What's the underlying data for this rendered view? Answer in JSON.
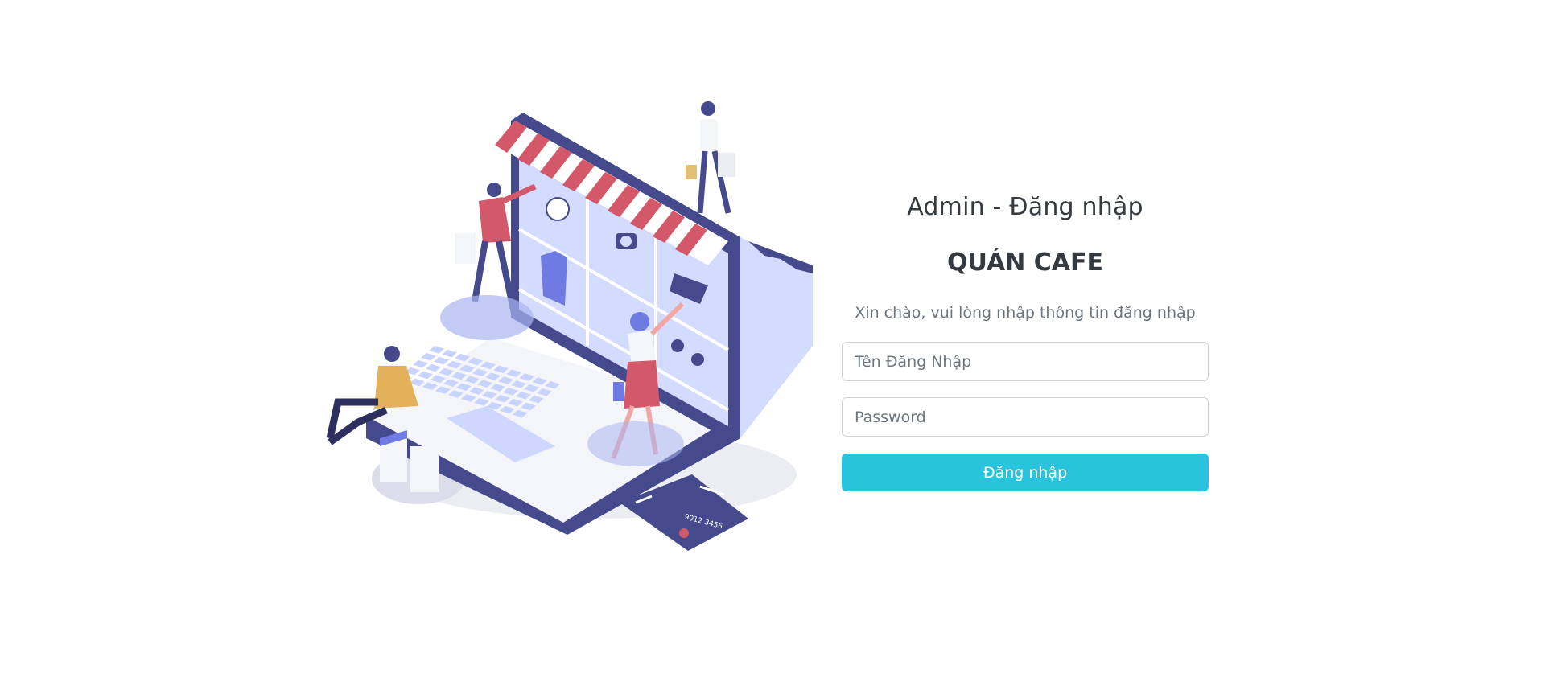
{
  "illustration": {
    "icon": "online-shop-illustration",
    "colors": {
      "primary": "#444a8c",
      "light_blue": "#d3dcff",
      "awning_red": "#d3586a",
      "accent_blue": "#6f7be3"
    },
    "card_text": "9012 3456"
  },
  "login": {
    "title": "Admin - Đăng nhập",
    "shop_name": "QUÁN CAFE",
    "subtitle": "Xin chào, vui lòng nhập thông tin đăng nhập",
    "username_placeholder": "Tên Đăng Nhập",
    "password_placeholder": "Password",
    "submit_label": "Đăng nhập",
    "button_color": "#29c4dc"
  }
}
